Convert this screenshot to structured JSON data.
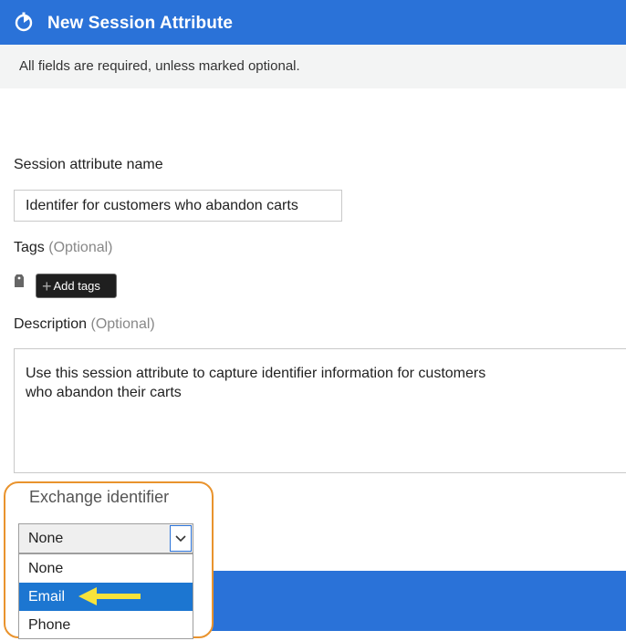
{
  "header": {
    "title": "New Session Attribute",
    "icon": "stopwatch-icon"
  },
  "notice": "All fields are required, unless marked optional.",
  "form": {
    "name_label": "Session attribute name",
    "name_value": "Identifer for customers who abandon carts",
    "tags_label": "Tags",
    "tags_optional": "(Optional)",
    "add_tags_label": "Add tags",
    "description_label": "Description",
    "description_optional": "(Optional)",
    "description_value": "Use this session attribute to capture identifier information for customers\nwho abandon their carts",
    "exchange_label": "Exchange identifier",
    "exchange_selected": "None",
    "exchange_options": [
      "None",
      "Email",
      "Phone"
    ],
    "exchange_highlighted": "Email"
  },
  "colors": {
    "accent": "#2a72d8",
    "callout": "#e9932d",
    "arrow": "#f6e23a"
  }
}
